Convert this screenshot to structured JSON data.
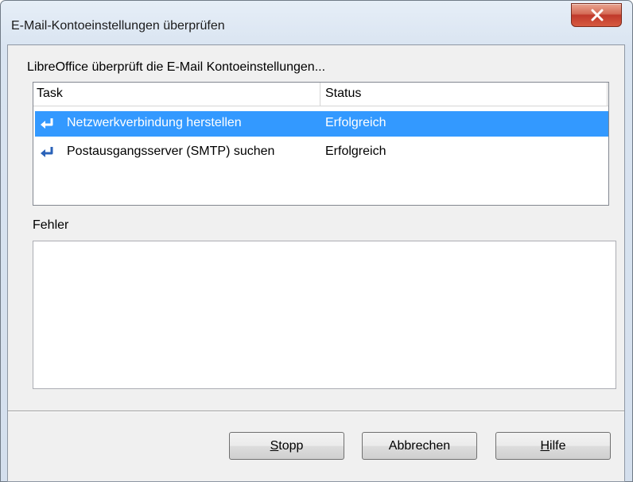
{
  "window": {
    "title": "E-Mail-Kontoeinstellungen überprüfen"
  },
  "intro_text": "LibreOffice überprüft die E-Mail Kontoeinstellungen...",
  "task_list": {
    "columns": [
      "Task",
      "Status"
    ],
    "rows": [
      {
        "task": "Netzwerkverbindung herstellen",
        "status": "Erfolgreich",
        "selected": true,
        "icon": "return-arrow-icon"
      },
      {
        "task": "Postausgangsserver (SMTP) suchen",
        "status": "Erfolgreich",
        "selected": false,
        "icon": "return-arrow-icon"
      }
    ]
  },
  "errors": {
    "label": "Fehler",
    "content": ""
  },
  "buttons": {
    "stop": {
      "label": "Stopp",
      "mnemonic": "S",
      "rest": "topp"
    },
    "cancel": {
      "label": "Abbrechen"
    },
    "help": {
      "label": "Hilfe",
      "mnemonic": "H",
      "rest": "ilfe"
    }
  },
  "colors": {
    "selection": "#3399ff",
    "close_button": "#c0392b",
    "icon": "#2a62b8"
  }
}
